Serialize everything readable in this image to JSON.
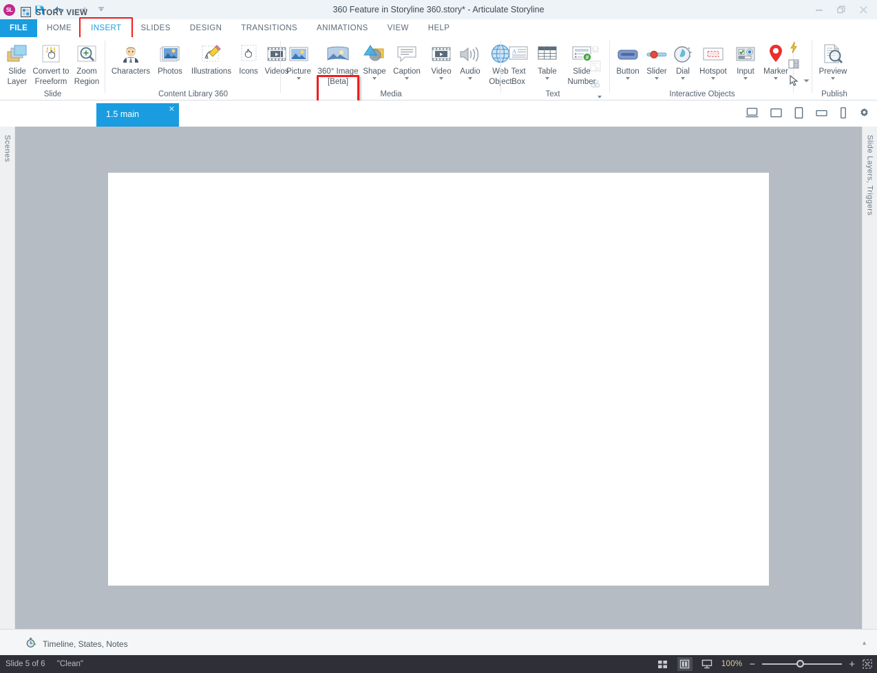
{
  "window": {
    "title": "360 Feature in Storyline 360.story* -  Articulate Storyline",
    "logo_text": "SL",
    "minimize_icon": "minimize-icon",
    "restore_icon": "restore-icon",
    "close_icon": "close-icon",
    "help_icon": "help-icon"
  },
  "quick_access": {
    "save_icon": "save-icon",
    "undo_icon": "undo-icon",
    "redo_icon": "redo-icon",
    "more_icon": "chevron-down-icon"
  },
  "ribbon": {
    "tabs": [
      {
        "label": "FILE"
      },
      {
        "label": "HOME"
      },
      {
        "label": "INSERT"
      },
      {
        "label": "SLIDES"
      },
      {
        "label": "DESIGN"
      },
      {
        "label": "TRANSITIONS"
      },
      {
        "label": "ANIMATIONS"
      },
      {
        "label": "VIEW"
      },
      {
        "label": "HELP"
      }
    ],
    "active_tab": "INSERT",
    "highlight_color": "#ef1d1d",
    "accent_color": "#1a9ce0",
    "groups": [
      {
        "name": "Slide",
        "label": "Slide",
        "items": [
          {
            "label": "Slide\nLayer",
            "line1": "Slide",
            "line2": "Layer",
            "icon": "slide-layer-icon",
            "caret": false
          },
          {
            "label": "Convert to Freeform",
            "line1": "Convert to",
            "line2": "Freeform",
            "icon": "convert-to-freeform-icon",
            "caret": false
          },
          {
            "label": "Zoom Region",
            "line1": "Zoom",
            "line2": "Region",
            "icon": "zoom-region-icon",
            "caret": false
          }
        ]
      },
      {
        "name": "Content Library 360",
        "label": "Content Library 360",
        "items": [
          {
            "line1": "Characters",
            "line2": "",
            "icon": "characters-icon",
            "caret": false
          },
          {
            "line1": "Photos",
            "line2": "",
            "icon": "photos-icon",
            "caret": false
          },
          {
            "line1": "Illustrations",
            "line2": "",
            "icon": "illustrations-icon",
            "caret": false
          },
          {
            "line1": "Icons",
            "line2": "",
            "icon": "icons-icon",
            "caret": false
          },
          {
            "line1": "Videos",
            "line2": "",
            "icon": "videos-icon",
            "caret": false
          }
        ]
      },
      {
        "name": "Media",
        "label": "Media",
        "items": [
          {
            "line1": "Picture",
            "line2": "",
            "icon": "picture-icon",
            "caret": true
          },
          {
            "line1": "360° Image",
            "line2": "[Beta]",
            "icon": "360-image-icon",
            "caret": false,
            "highlighted": true
          },
          {
            "line1": "Shape",
            "line2": "",
            "icon": "shape-icon",
            "caret": true
          },
          {
            "line1": "Caption",
            "line2": "",
            "icon": "caption-icon",
            "caret": true
          },
          {
            "line1": "Video",
            "line2": "",
            "icon": "video-icon",
            "caret": true
          },
          {
            "line1": "Audio",
            "line2": "",
            "icon": "audio-icon",
            "caret": true
          },
          {
            "line1": "Web",
            "line2": "Object",
            "icon": "web-object-icon",
            "caret": false
          }
        ]
      },
      {
        "name": "Text",
        "label": "Text",
        "items": [
          {
            "line1": "Text",
            "line2": "Box",
            "icon": "text-box-icon",
            "caret": false
          },
          {
            "line1": "Table",
            "line2": "",
            "icon": "table-icon",
            "caret": true
          },
          {
            "line1": "Slide",
            "line2": "Number",
            "icon": "slide-number-icon",
            "caret": true
          }
        ],
        "small_items": [
          {
            "icon": "symbol-omega-icon",
            "disabled": true
          },
          {
            "icon": "reference-fx-icon",
            "disabled": true
          },
          {
            "icon": "hyperlink-icon",
            "disabled": true
          }
        ]
      },
      {
        "name": "Interactive Objects",
        "label": "Interactive Objects",
        "items": [
          {
            "line1": "Button",
            "line2": "",
            "icon": "button-icon",
            "caret": true
          },
          {
            "line1": "Slider",
            "line2": "",
            "icon": "slider-icon",
            "caret": true
          },
          {
            "line1": "Dial",
            "line2": "",
            "icon": "dial-icon",
            "caret": true
          },
          {
            "line1": "Hotspot",
            "line2": "",
            "icon": "hotspot-icon",
            "caret": true
          },
          {
            "line1": "Input",
            "line2": "",
            "icon": "input-icon",
            "caret": true
          },
          {
            "line1": "Marker",
            "line2": "",
            "icon": "marker-icon",
            "caret": true
          }
        ],
        "small_items": [
          {
            "icon": "trigger-bolt-icon",
            "disabled": false
          },
          {
            "icon": "panel-icon",
            "disabled": false
          },
          {
            "icon": "mouse-cursor-icon",
            "disabled": false,
            "caret": true
          }
        ]
      },
      {
        "name": "Publish",
        "label": "Publish",
        "items": [
          {
            "line1": "Preview",
            "line2": "",
            "icon": "preview-icon",
            "caret": true
          }
        ]
      }
    ]
  },
  "docbar": {
    "story_view_label": "STORY VIEW",
    "story_view_icon": "story-view-icon",
    "slide_tab_label": "1.5 main",
    "slide_tab_close_icon": "close-icon",
    "device_icons": [
      {
        "name": "device-desktop-icon"
      },
      {
        "name": "device-square-icon"
      },
      {
        "name": "device-tablet-portrait-icon"
      },
      {
        "name": "device-tablet-landscape-icon"
      },
      {
        "name": "device-phone-icon"
      },
      {
        "name": "player-settings-gear-icon"
      }
    ]
  },
  "workspace": {
    "left_panel_label": "Scenes",
    "right_panel_label": "Slide Layers, Triggers",
    "canvas_bg": "#b6bcc4",
    "slide_bg": "#ffffff"
  },
  "timeline": {
    "label": "Timeline, States, Notes",
    "icon": "timeline-icon",
    "collapse_icon": "chevron-up-icon"
  },
  "statusbar": {
    "slide_position": "Slide 5 of 6",
    "theme_name": "\"Clean\"",
    "zoom_label": "100%",
    "zoom_value": 100,
    "views": [
      {
        "name": "normal-view-icon",
        "selected": false
      },
      {
        "name": "slide-view-icon",
        "selected": true
      },
      {
        "name": "presenter-view-icon",
        "selected": false
      }
    ],
    "zoom_out_icon": "minus-icon",
    "zoom_in_icon": "plus-icon",
    "fit_to_window_icon": "fit-to-window-icon",
    "background": "#2f3037",
    "zoom_text_color": "#d8cf9e"
  }
}
